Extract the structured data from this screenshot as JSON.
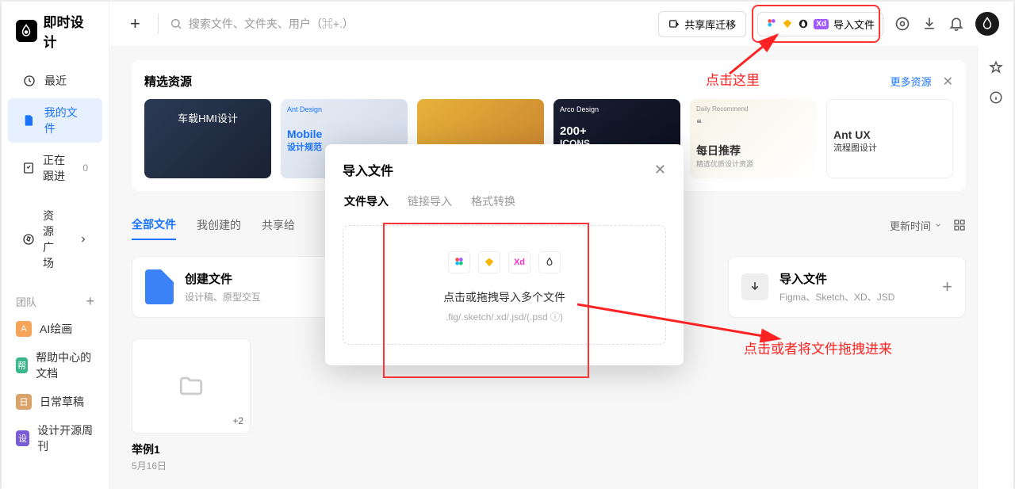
{
  "logo": {
    "text": "即时设计"
  },
  "sidebar": {
    "recent": "最近",
    "my_files": "我的文件",
    "following": "正在跟进",
    "following_count": "0",
    "resources": "资源广场",
    "team_header": "团队",
    "teams": [
      {
        "badge": "A",
        "color": "#f5a45a",
        "label": "AI绘画"
      },
      {
        "badge": "帮",
        "color": "#39b58a",
        "label": "帮助中心的文档"
      },
      {
        "badge": "日",
        "color": "#d9a36a",
        "label": "日常草稿"
      },
      {
        "badge": "设",
        "color": "#7a5cd6",
        "label": "设计开源周刊"
      }
    ]
  },
  "topbar": {
    "search_placeholder": "搜索文件、文件夹、用户（⌘+.）",
    "share_migrate": "共享库迁移",
    "import_file": "导入文件"
  },
  "featured": {
    "title": "精选资源",
    "more": "更多资源",
    "cards": [
      {
        "title": "车载HMI设计"
      },
      {
        "brand": "Ant Design",
        "title": "Mobile",
        "sub": "设计规范"
      },
      {
        "title": ""
      },
      {
        "brand": "Arco Design",
        "title": "200+",
        "sub": "ICONS"
      },
      {
        "brand": "Daily Recommend",
        "title": "每日推荐",
        "sub": "精选优质设计资源"
      },
      {
        "title": "Ant UX",
        "sub": "流程图设计"
      }
    ]
  },
  "tabs": {
    "all": "全部文件",
    "mine": "我创建的",
    "shared": "共享给",
    "sort": "更新时间"
  },
  "file_cards": {
    "create_title": "创建文件",
    "create_sub": "设计稿、原型交互",
    "import_title": "导入文件",
    "import_sub": "Figma、Sketch、XD、JSD"
  },
  "folder": {
    "count": "+2",
    "name": "举例1",
    "date": "5月16日"
  },
  "modal": {
    "title": "导入文件",
    "tab_file": "文件导入",
    "tab_link": "链接导入",
    "tab_convert": "格式转换",
    "dz_line1": "点击或拖拽导入多个文件",
    "dz_line2": ".fig/.sketch/.xd/.jsd/(.psd ⓘ)",
    "xd": "Xd"
  },
  "annotations": {
    "click_here": "点击这里",
    "drag_here": "点击或者将文件拖拽进来"
  }
}
